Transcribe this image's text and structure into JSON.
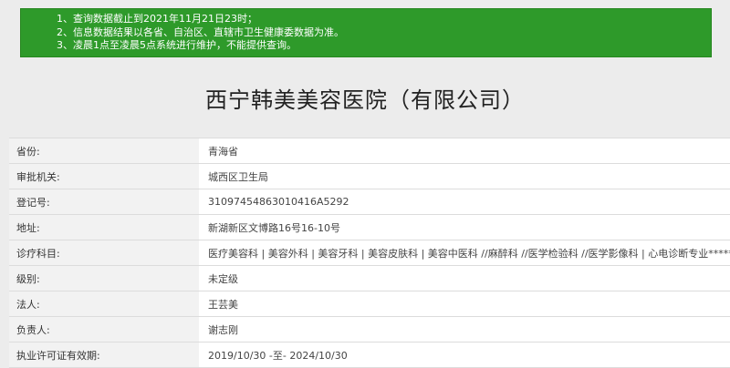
{
  "notice": {
    "lines": [
      "1、查询数据截止到2021年11月21日23时；",
      "2、信息数据结果以各省、自治区、直辖市卫生健康委数据为准。",
      "3、凌晨1点至凌晨5点系统进行维护，不能提供查询。"
    ],
    "background_color": "#2e9a2a"
  },
  "title": "西宁韩美美容医院（有限公司）",
  "rows": [
    {
      "label": "省份:",
      "value": "青海省"
    },
    {
      "label": "审批机关:",
      "value": "城西区卫生局"
    },
    {
      "label": "登记号:",
      "value": "31097454863010416A5292"
    },
    {
      "label": "地址:",
      "value": "新湖新区文博路16号16-10号"
    },
    {
      "label": "诊疗科目:",
      "value": "医疗美容科 | 美容外科 | 美容牙科 | 美容皮肤科 | 美容中医科 //麻醉科 //医学检验科 //医学影像科 | 心电诊断专业******"
    },
    {
      "label": "级别:",
      "value": "未定级"
    },
    {
      "label": "法人:",
      "value": "王芸美"
    },
    {
      "label": "负责人:",
      "value": "谢志刚"
    },
    {
      "label": "执业许可证有效期:",
      "value": "2019/10/30 -至- 2024/10/30"
    }
  ]
}
